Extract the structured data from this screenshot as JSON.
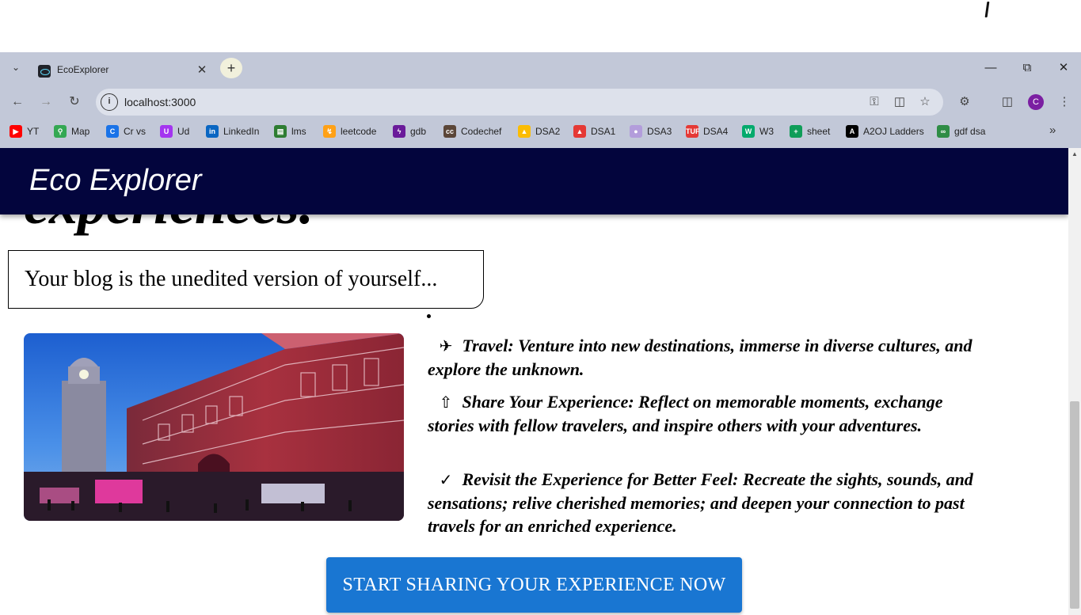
{
  "browser": {
    "tab_title": "EcoExplorer",
    "url": "localhost:3000",
    "bookmarks": [
      {
        "label": "YT",
        "color": "#ff0000"
      },
      {
        "label": "Map",
        "color": "#34a853"
      },
      {
        "label": "Cr vs",
        "color": "#1a73e8"
      },
      {
        "label": "Ud",
        "color": "#a435f0"
      },
      {
        "label": "LinkedIn",
        "color": "#0a66c2"
      },
      {
        "label": "lms",
        "color": "#2e7d32"
      },
      {
        "label": "leetcode",
        "color": "#ffa116"
      },
      {
        "label": "gdb",
        "color": "#6a1b9a"
      },
      {
        "label": "Codechef",
        "color": "#5b4638"
      },
      {
        "label": "DSA2",
        "color": "#fbbc04"
      },
      {
        "label": "DSA1",
        "color": "#e53935"
      },
      {
        "label": "DSA3",
        "color": "#b39ddb"
      },
      {
        "label": "DSA4",
        "color": "#e53935"
      },
      {
        "label": "W3",
        "color": "#04aa6d"
      },
      {
        "label": "sheet",
        "color": "#0f9d58"
      },
      {
        "label": "A2OJ Ladders",
        "color": "#000000"
      },
      {
        "label": "gdf dsa",
        "color": "#2f8d46"
      }
    ],
    "profile_initial": "C"
  },
  "page": {
    "brand": "Eco Explorer",
    "hero_heading_partial": "experiences.",
    "quote": "Your blog is the unedited version of yourself...",
    "features": [
      {
        "icon": "flight-takeoff-icon",
        "text": "Travel: Venture into new destinations, immerse in diverse cultures, and explore the unknown."
      },
      {
        "icon": "share-icon",
        "text": "Share Your Experience: Reflect on memorable moments, exchange stories with fellow travelers, and inspire others with your adventures."
      },
      {
        "icon": "done-all-icon",
        "text": "Revisit the Experience for Better Feel: Recreate the sights, sounds, and sensations; relive cherished memories; and deepen your connection to past travels for an enriched experience."
      }
    ],
    "cta_label": "START SHARING YOUR EXPERIENCE NOW",
    "colors": {
      "navbar": "#03053d",
      "cta": "#1976d2"
    }
  }
}
